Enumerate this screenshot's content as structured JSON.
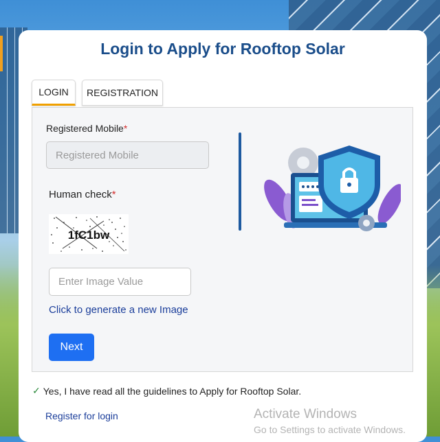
{
  "title": "Login to Apply for Rooftop Solar",
  "tabs": [
    {
      "label": "LOGIN",
      "active": true
    },
    {
      "label": "REGISTRATION",
      "active": false
    }
  ],
  "form": {
    "mobile_label": "Registered Mobile",
    "mobile_placeholder": "Registered Mobile",
    "required_mark": "*",
    "human_check_label": "Human check",
    "captcha_text": "1fC1bw",
    "image_placeholder": "Enter Image Value",
    "generate_link": "Click to generate a new Image",
    "next_label": "Next"
  },
  "agreement": "Yes, I have read all the guidelines to Apply for Rooftop Solar.",
  "register_link": "Register for login",
  "watermark": {
    "line1": "Activate Windows",
    "line2": "Go to Settings to activate Windows."
  },
  "colors": {
    "title": "#1a4d8a",
    "active_tab_border": "#f0a000",
    "next_button": "#1e6ff2",
    "link": "#1a3d9a",
    "required": "#d32f2f",
    "check": "#2e8b3e"
  },
  "icons": {
    "check": "checkmark-icon",
    "illustration": "security-shield-laptop-illustration"
  }
}
